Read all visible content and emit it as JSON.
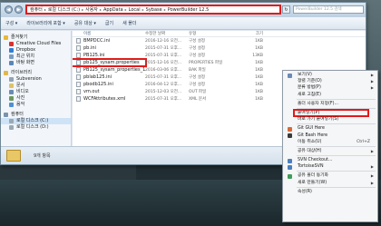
{
  "address_bar": {
    "crumbs": [
      "컴퓨터",
      "로컬 디스크 (C:)",
      "사용자",
      "AppData",
      "Local",
      "Sybase",
      "PowerBuilder 12.5"
    ]
  },
  "search_placeholder": "PowerBuilder 12.5 검색",
  "toolbar": {
    "items": [
      "구성 ▾",
      "라이브러리에 포함 ▾",
      "공유 대상 ▾",
      "굽기",
      "새 폴더"
    ]
  },
  "nav": {
    "items": [
      {
        "label": "즐겨찾기",
        "icon": "star-icon",
        "color": "#e7b93a",
        "group": true
      },
      {
        "label": "Creative Cloud Files",
        "icon": "cloud-icon",
        "color": "#d9312f"
      },
      {
        "label": "Dropbox",
        "icon": "dropbox-icon",
        "color": "#2f7fd6"
      },
      {
        "label": "최근 위치",
        "icon": "clock-icon",
        "color": "#7a9cc3"
      },
      {
        "label": "바탕 화면",
        "icon": "desktop-icon",
        "color": "#5c86b6"
      },
      {
        "label": "라이브러리",
        "icon": "library-icon",
        "color": "#e0b94a",
        "group": true
      },
      {
        "label": "Subversion",
        "icon": "subversion-icon",
        "color": "#8fa3b6"
      },
      {
        "label": "문서",
        "icon": "document-icon",
        "color": "#e0c16a"
      },
      {
        "label": "비디오",
        "icon": "video-icon",
        "color": "#6b8bb0"
      },
      {
        "label": "사진",
        "icon": "picture-icon",
        "color": "#6b9a5c"
      },
      {
        "label": "음악",
        "icon": "music-icon",
        "color": "#4f8fd4"
      },
      {
        "label": "컴퓨터",
        "icon": "computer-icon",
        "color": "#7a93ad",
        "group": true
      },
      {
        "label": "로컬 디스크 (C:)",
        "icon": "drive-icon",
        "color": "#9aa8b5",
        "selected": true
      },
      {
        "label": "로컬 디스크 (D:)",
        "icon": "drive-icon",
        "color": "#9aa8b5"
      }
    ]
  },
  "file_list": {
    "headers": {
      "name": "이름",
      "date": "수정한 날짜",
      "type": "유형",
      "size": "크기"
    },
    "rows": [
      {
        "name": "BMPDCC.ini",
        "date": "2016-12-16 오전...",
        "type": "구성 설정",
        "size": "1KB"
      },
      {
        "name": "pb.ini",
        "date": "2015-07-31 오후...",
        "type": "구성 설정",
        "size": "1KB"
      },
      {
        "name": "PB125.ini",
        "date": "2015-07-31 오후...",
        "type": "구성 설정",
        "size": "13KB"
      },
      {
        "name": "pb125_sysam.properties",
        "date": "2015-12-16 오전...",
        "type": "PROPERTIES 파일",
        "size": "1KB",
        "selected": true
      },
      {
        "name": "PB125_sysam_properties_1.bak",
        "date": "2016-03-06 오후...",
        "type": "BAK 파일",
        "size": "1KB"
      },
      {
        "name": "pblab125.ini",
        "date": "2015-07-31 오후...",
        "type": "구성 설정",
        "size": "1KB"
      },
      {
        "name": "pbodb125.ini",
        "date": "2016-04-12 오후...",
        "type": "구성 설정",
        "size": "1KB"
      },
      {
        "name": "vm.out",
        "date": "2015-12-03 오전...",
        "type": "OUT 파일",
        "size": "1KB"
      },
      {
        "name": "WCFAttributes.xml",
        "date": "2015-07-31 오후...",
        "type": "XML 문서",
        "size": "1KB"
      }
    ]
  },
  "status_bar": {
    "text": "9개 항목"
  },
  "context_menu": {
    "items": [
      {
        "label": "보기(V)",
        "arrow": true,
        "icon": "view-icon",
        "color": "#6a8bb3"
      },
      {
        "label": "정렬 기준(O)",
        "arrow": true
      },
      {
        "label": "분류 방법(P)",
        "arrow": true
      },
      {
        "label": "새로 고침(E)"
      },
      {
        "sep": true
      },
      {
        "label": "폴더 사용자 지정(F)..."
      },
      {
        "sep": true
      },
      {
        "label": "붙여넣기(P)",
        "highlight": true
      },
      {
        "label": "바로 가기 붙여넣기(S)"
      },
      {
        "sep": true
      },
      {
        "label": "Git GUI Here",
        "icon": "git-gui-icon",
        "color": "#d46a3a"
      },
      {
        "label": "Git Bash Here",
        "icon": "git-bash-icon",
        "color": "#3a3a3a"
      },
      {
        "label": "이동 취소(U)",
        "shortcut": "Ctrl+Z"
      },
      {
        "sep": true
      },
      {
        "label": "공유 대상(H)",
        "arrow": true
      },
      {
        "sep": true
      },
      {
        "label": "SVN Checkout...",
        "icon": "svn-checkout-icon",
        "color": "#4b7fbf"
      },
      {
        "label": "TortoiseSVN",
        "arrow": true,
        "icon": "tortoisesvn-icon",
        "color": "#4b7fbf"
      },
      {
        "sep": true
      },
      {
        "label": "공유 폴더 동기화",
        "arrow": true,
        "icon": "sync-icon",
        "color": "#3f9c5a"
      },
      {
        "label": "새로 만들기(W)",
        "arrow": true
      },
      {
        "sep": true
      },
      {
        "label": "속성(R)"
      }
    ]
  }
}
